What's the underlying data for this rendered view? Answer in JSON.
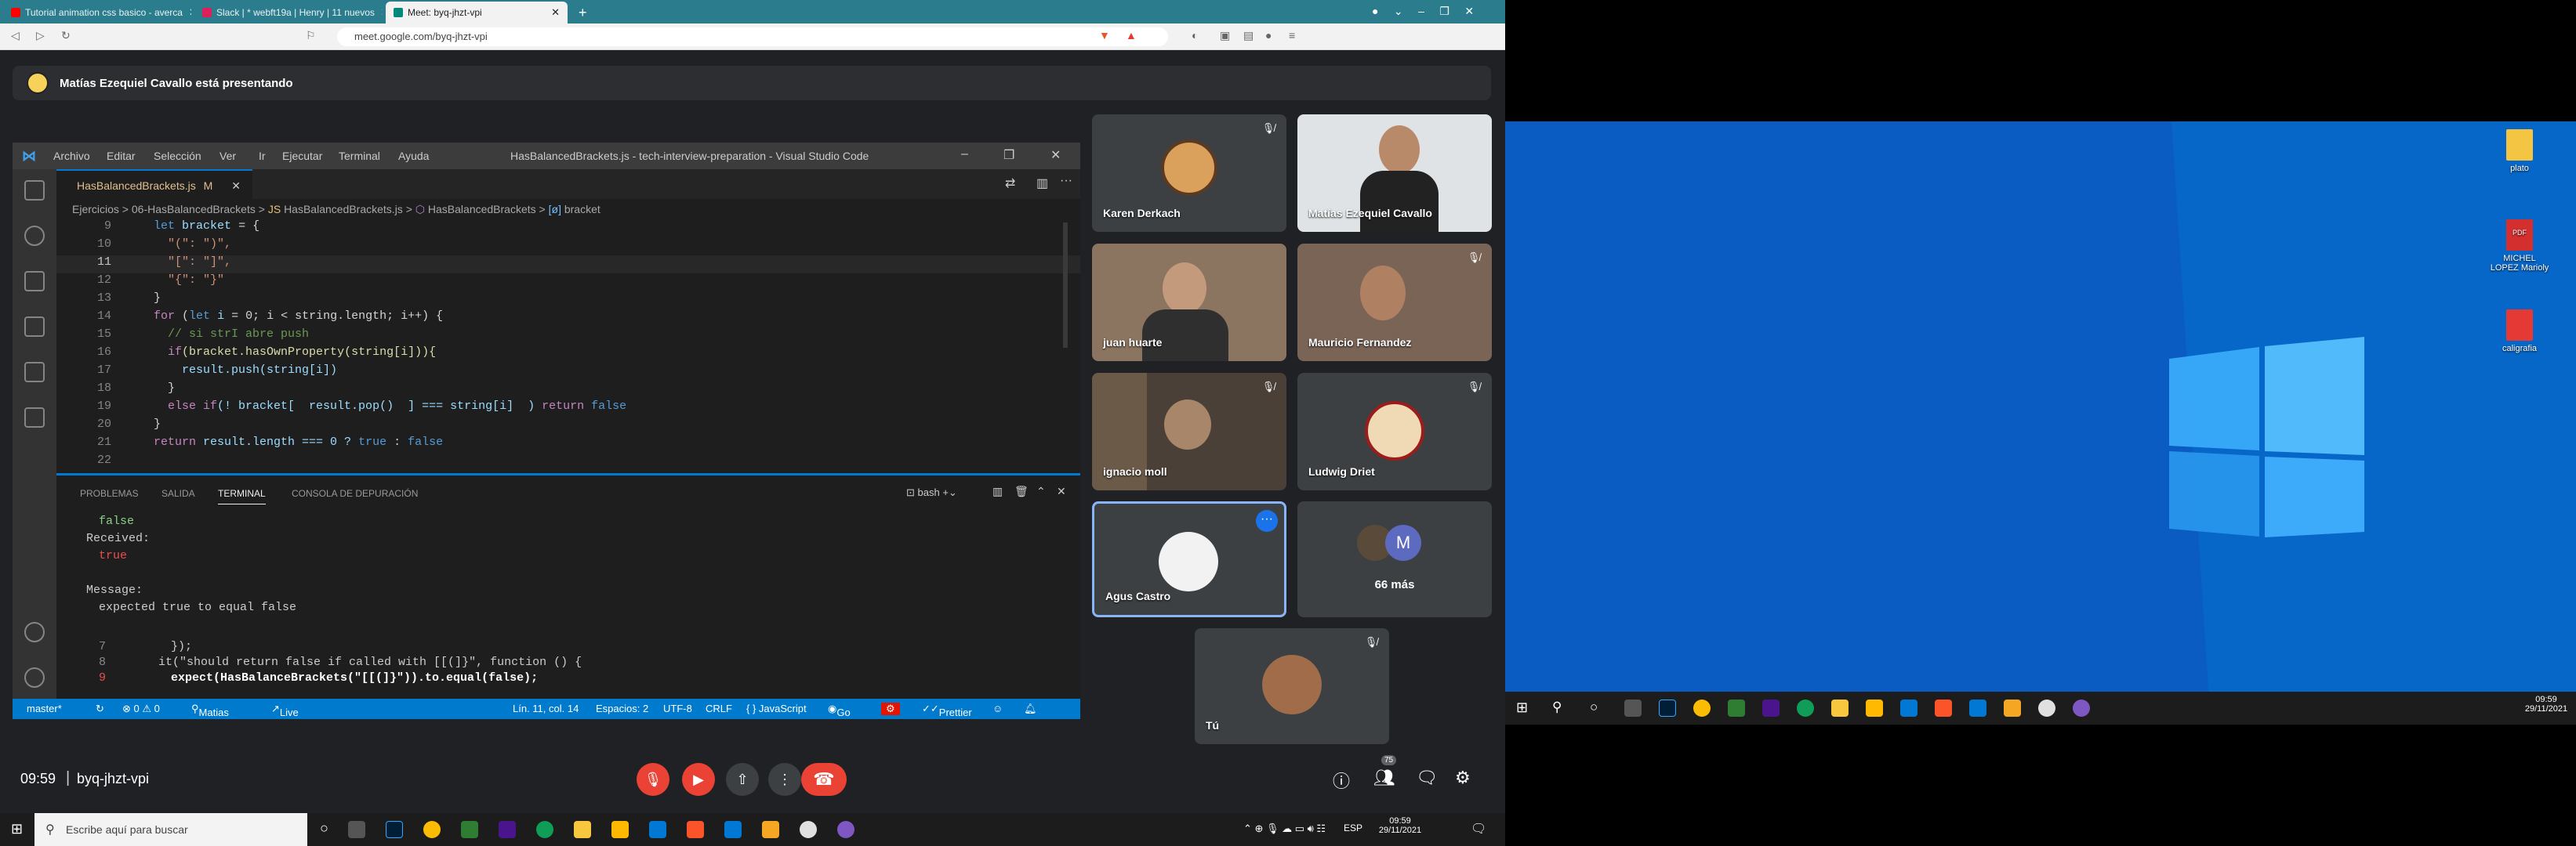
{
  "browser": {
    "tabs": [
      {
        "label": "Tutorial animation css basico - averca",
        "color": "#ff0000"
      },
      {
        "label": "Slack | * webft19a | Henry | 11 nuevos",
        "color": "#e01e5a"
      },
      {
        "label": "Meet: byq-jhzt-vpi",
        "color": "#00897b"
      }
    ],
    "url": "meet.google.com/byq-jhzt-vpi",
    "new_tab": "+"
  },
  "meet": {
    "presenting_banner": "Matías Ezequiel Cavallo está presentando",
    "time": "09:59",
    "meeting_code": "byq-jhzt-vpi",
    "participant_count": "75",
    "more_count_label": "66 más",
    "more_avatar_letter": "M",
    "participants": [
      {
        "name": "Karen Derkach"
      },
      {
        "name": "Matías Ezequiel Cavallo"
      },
      {
        "name": "juan huarte"
      },
      {
        "name": "Mauricio Fernandez"
      },
      {
        "name": "ignacio moll"
      },
      {
        "name": "Ludwig Driet"
      },
      {
        "name": "Agus Castro"
      },
      {
        "name": "Tú"
      }
    ]
  },
  "vscode": {
    "menu": [
      "Archivo",
      "Editar",
      "Selección",
      "Ver",
      "Ir",
      "Ejecutar",
      "Terminal",
      "Ayuda"
    ],
    "window_title": "HasBalancedBrackets.js - tech-interview-preparation - Visual Studio Code",
    "editor_tab": "HasBalancedBrackets.js",
    "editor_tab_flag": "M",
    "breadcrumb": [
      "Ejercicios",
      "06-HasBalancedBrackets",
      "HasBalancedBrackets.js",
      "HasBalancedBrackets",
      "bracket"
    ],
    "panel_tabs": [
      "PROBLEMAS",
      "SALIDA",
      "TERMINAL",
      "CONSOLA DE DEPURACIÓN"
    ],
    "shell": "bash",
    "terminal": {
      "l1": "false",
      "l2": "Received:",
      "l3": "true",
      "l4": "Message:",
      "l5": "expected true to equal false",
      "l6n": "7",
      "l6": "});",
      "l7n": "8",
      "l7": "it(\"should return false if called with [[(]}\", function () {",
      "l8n": "9",
      "l8": "expect(HasBalanceBrackets(\"[[(]}\")).to.equal(false);"
    },
    "status": {
      "branch": "master*",
      "problems": "⊗ 0 ⚠ 0",
      "user": "Matias",
      "live_share": "Live Share",
      "position": "Lín. 11, col. 14",
      "spaces": "Espacios: 2",
      "encoding": "UTF-8",
      "eol": "CRLF",
      "language": "{ } JavaScript",
      "go_live": "Go Live",
      "prettier": "Prettier"
    }
  },
  "code_lines": [
    {
      "n": "9"
    },
    {
      "n": "10"
    },
    {
      "n": "11"
    },
    {
      "n": "12"
    },
    {
      "n": "13"
    },
    {
      "n": "14"
    },
    {
      "n": "15"
    },
    {
      "n": "16"
    },
    {
      "n": "17"
    },
    {
      "n": "18"
    },
    {
      "n": "19"
    },
    {
      "n": "20"
    },
    {
      "n": "21"
    },
    {
      "n": "22"
    }
  ],
  "code": {
    "let": "let",
    "bracket": "bracket",
    "eqbrace": " = {",
    "p1": "\"(\": \")\",",
    "p2": "\"[\": \"]\",",
    "p3": "\"{\": \"}\"",
    "close": "}",
    "for": "for",
    "letk": "let",
    "i": "i",
    "for_rest": " = 0; i < string.length; i++) {",
    "comment": "// si strI abre push",
    "if1": "if",
    "cond1": "(bracket.hasOwnProperty(string[i])){",
    "push": "result.push(string[i])",
    "else": "else if",
    "cond2": "(! bracket[  result.pop()  ] === string[i]  )",
    "ret": "return",
    "false": "false",
    "ret2": "return",
    "ret2_rest": " result.length === 0 ? ",
    "true": "true",
    "colon": " : ",
    "false2": "false"
  },
  "taskbar": {
    "search_placeholder": "Escribe aquí para buscar",
    "clock_time": "09:59",
    "clock_date": "29/11/2021",
    "lang": "ESP"
  },
  "desktop": {
    "icons": [
      {
        "label": "plato"
      },
      {
        "label": "MICHEL LOPEZ Marioly"
      },
      {
        "label": "caligrafia"
      }
    ],
    "pdf_badge": "PDF",
    "clock_time": "09:59",
    "clock_date": "29/11/2021"
  }
}
